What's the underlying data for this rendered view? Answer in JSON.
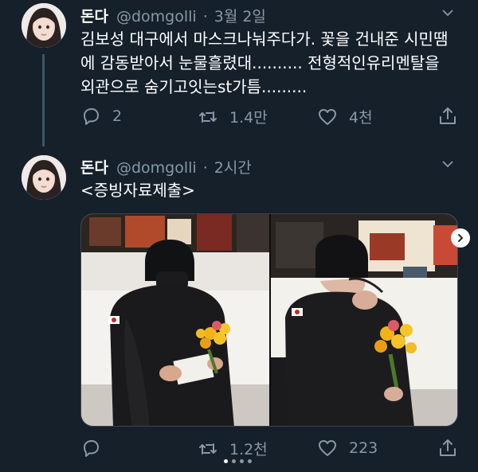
{
  "tweets": [
    {
      "name": "돈다",
      "handle": "@domgolli",
      "separator": "·",
      "time": "3월 2일",
      "text": "김보성 대구에서 마스크나눠주다가. 꽃을 건내준 시민땜에 감동받아서 눈물흘렸대.......... 전형적인유리멘탈을 외관으로 숨기고잇는st가틈.........",
      "replies": "2",
      "retweets": "1.4만",
      "likes": "4천"
    },
    {
      "name": "돈다",
      "handle": "@domgolli",
      "separator": "·",
      "time": "2시간",
      "text": "<증빙자료제출>",
      "replies": "",
      "retweets": "1.2천",
      "likes": "223"
    }
  ],
  "icons": {
    "reply": "speech-bubble-icon",
    "retweet": "retweet-icon",
    "like": "heart-icon",
    "share": "share-icon",
    "caret": "chevron-down-icon",
    "next": "chevron-right-icon"
  },
  "colors": {
    "background": "#15202b",
    "secondary_text": "#8899a6",
    "divider": "#38444d"
  },
  "carousel": {
    "total": 4,
    "current": 1
  }
}
